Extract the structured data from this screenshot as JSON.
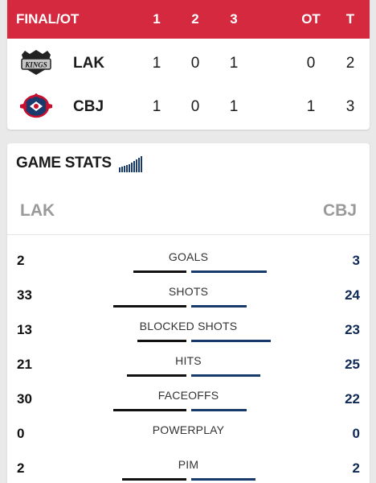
{
  "scoreboard": {
    "status": "FINAL/OT",
    "periods": [
      "1",
      "2",
      "3",
      "OT",
      "T"
    ],
    "teams": [
      {
        "abbr": "LAK",
        "logo_icon": "kings-logo-icon",
        "scores": [
          "1",
          "0",
          "1",
          "0",
          "2"
        ]
      },
      {
        "abbr": "CBJ",
        "logo_icon": "blue-jackets-logo-icon",
        "scores": [
          "1",
          "0",
          "1",
          "1",
          "3"
        ]
      }
    ]
  },
  "game_stats": {
    "title": "GAME STATS",
    "title_icon": "signal-bars-icon",
    "left_team": "LAK",
    "right_team": "CBJ",
    "stats": [
      {
        "name": "GOALS",
        "left": "2",
        "right": "3"
      },
      {
        "name": "SHOTS",
        "left": "33",
        "right": "24"
      },
      {
        "name": "BLOCKED SHOTS",
        "left": "13",
        "right": "23"
      },
      {
        "name": "HITS",
        "left": "21",
        "right": "25"
      },
      {
        "name": "FACEOFFS",
        "left": "30",
        "right": "22"
      },
      {
        "name": "POWERPLAY",
        "left": "0",
        "right": "0"
      },
      {
        "name": "PIM",
        "left": "2",
        "right": "2"
      }
    ]
  },
  "colors": {
    "header_red": "#d4293f",
    "cbj_navy": "#173a6b",
    "lak_black": "#111111"
  }
}
